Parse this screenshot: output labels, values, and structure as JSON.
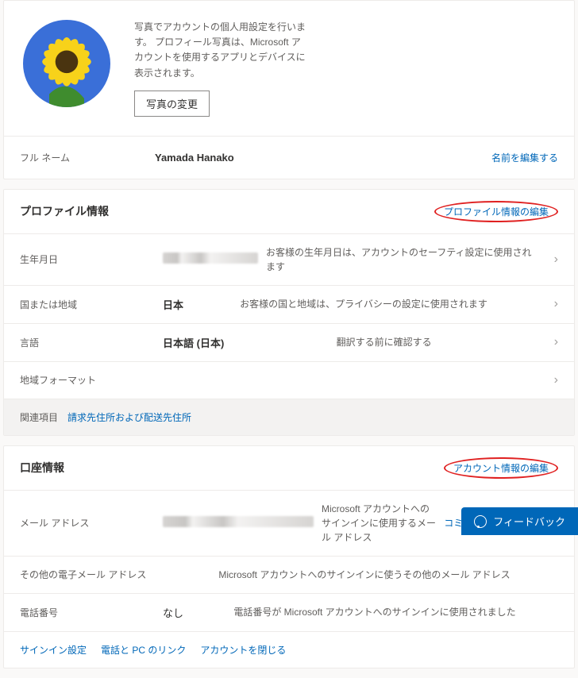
{
  "photo": {
    "desc": "写真でアカウントの個人用設定を行います。 プロフィール写真は、Microsoft アカウントを使用するアプリとデバイスに表示されます。",
    "change_btn": "写真の変更"
  },
  "name": {
    "label": "フル ネーム",
    "value": "Yamada Hanako",
    "edit": "名前を編集する"
  },
  "profile": {
    "title": "プロファイル情報",
    "edit": "プロファイル情報の編集",
    "rows": {
      "dob": {
        "label": "生年月日",
        "desc": "お客様の生年月日は、アカウントのセーフティ設定に使用されます"
      },
      "country": {
        "label": "国または地域",
        "value": "日本",
        "desc": "お客様の国と地域は、プライバシーの設定に使用されます"
      },
      "lang": {
        "label": "言語",
        "value": "日本語 (日本)",
        "desc": "翻訳する前に確認する"
      },
      "region": {
        "label": "地域フォーマット"
      }
    },
    "related": {
      "label": "関連項目",
      "link": "請求先住所および配送先住所"
    }
  },
  "account": {
    "title": "口座情報",
    "edit": "アカウント情報の編集",
    "rows": {
      "email": {
        "label": "メール アドレス",
        "desc": "Microsoft アカウントへのサインインに使用するメール アドレス",
        "link": "コミュニケーションの設定"
      },
      "other_email": {
        "label": "その他の電子メール アドレス",
        "desc": "Microsoft アカウントへのサインインに使うその他のメール アドレス"
      },
      "phone": {
        "label": "電話番号",
        "value": "なし",
        "desc": "電話番号が Microsoft アカウントへのサインインに使用されました"
      }
    },
    "footer": {
      "signin": "サインイン設定",
      "link_pc": "電話と PC のリンク",
      "close": "アカウントを閉じる"
    }
  },
  "feedback": "フィードバック"
}
